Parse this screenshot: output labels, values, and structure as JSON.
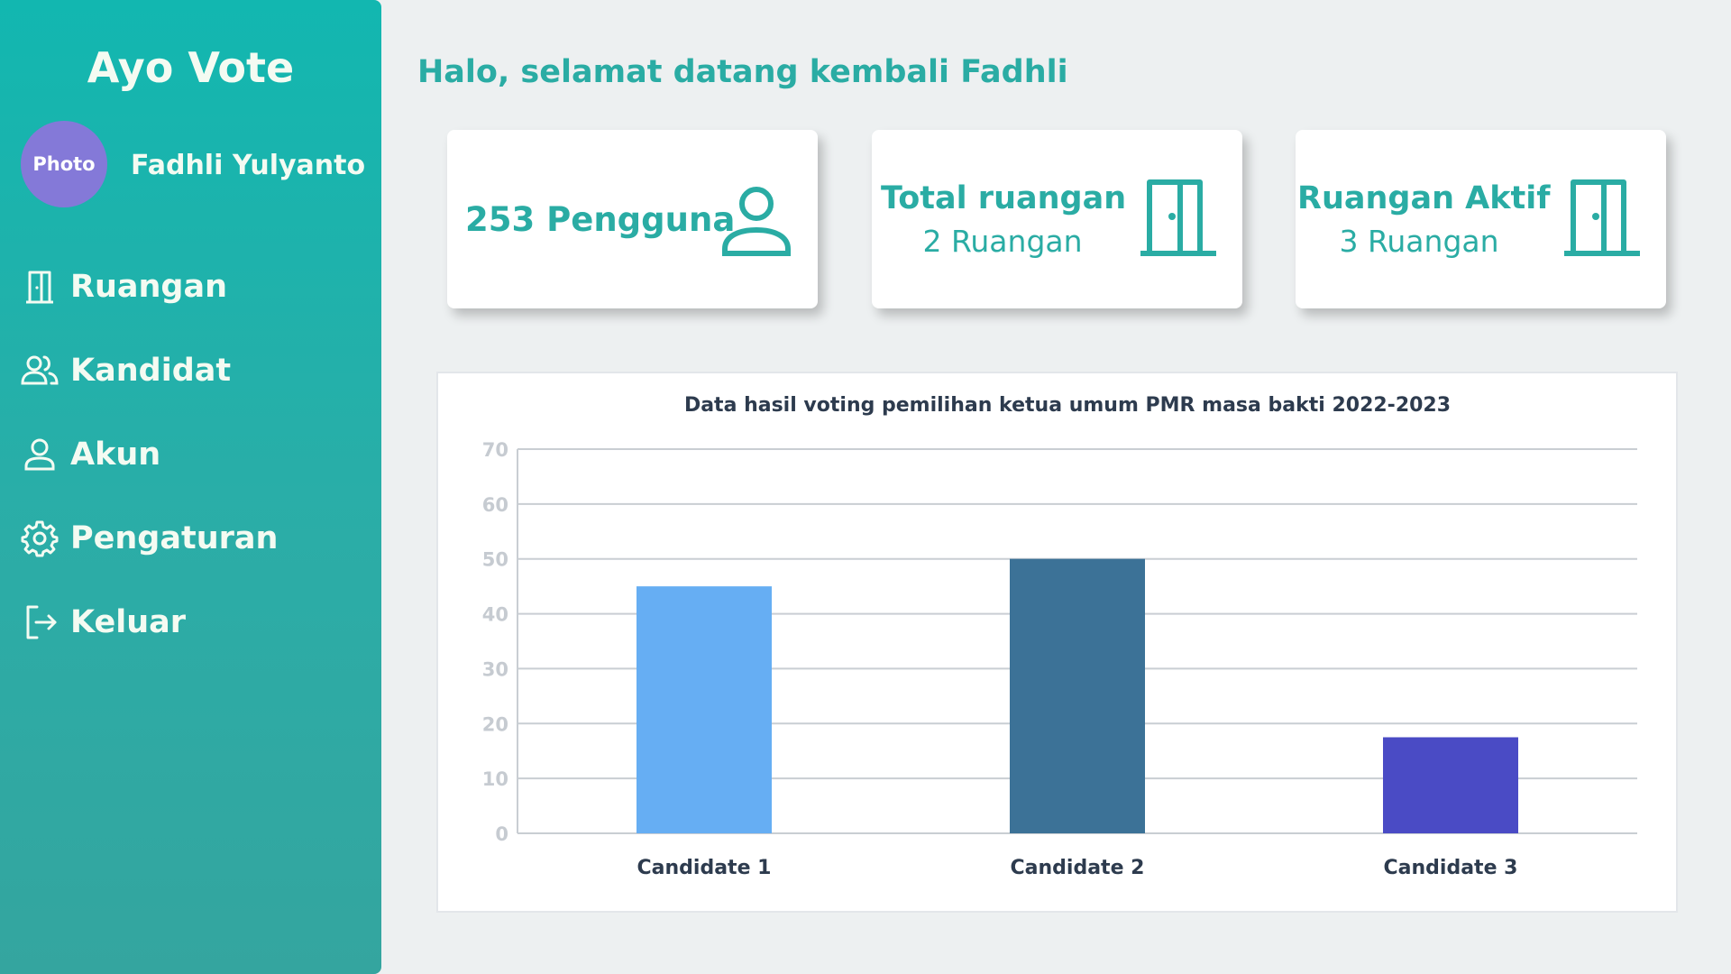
{
  "app": {
    "title": "Ayo Vote"
  },
  "user": {
    "avatar_label": "Photo",
    "name": "Fadhli Yulyanto"
  },
  "nav": [
    {
      "label": "Ruangan",
      "icon": "door-icon"
    },
    {
      "label": "Kandidat",
      "icon": "users-icon"
    },
    {
      "label": "Akun",
      "icon": "user-icon"
    },
    {
      "label": "Pengaturan",
      "icon": "gear-icon"
    },
    {
      "label": "Keluar",
      "icon": "logout-icon"
    }
  ],
  "greeting": "Halo, selamat datang kembali Fadhli",
  "stats": {
    "users": {
      "text": "253 Pengguna",
      "icon": "user-icon"
    },
    "total_rooms": {
      "title": "Total ruangan",
      "value": "2 Ruangan",
      "icon": "door-icon"
    },
    "active_rooms": {
      "title": "Ruangan Aktif",
      "value": "3 Ruangan",
      "icon": "door-icon"
    }
  },
  "colors": {
    "accent": "#2aaca4",
    "sidebar_top": "#12b7b0",
    "sidebar_bottom": "#34a59f",
    "avatar": "#8479d8"
  },
  "chart_data": {
    "type": "bar",
    "title": "Data hasil voting pemilihan ketua umum PMR masa bakti 2022-2023",
    "categories": [
      "Candidate 1",
      "Candidate 2",
      "Candidate 3"
    ],
    "values": [
      45,
      50,
      17.5
    ],
    "colors": [
      "#66aef3",
      "#3c7297",
      "#4a4bc5"
    ],
    "ylim": [
      0,
      70
    ],
    "yticks": [
      0,
      10,
      20,
      30,
      40,
      50,
      60,
      70
    ],
    "xlabel": "",
    "ylabel": "",
    "grid": true,
    "legend": "none"
  }
}
